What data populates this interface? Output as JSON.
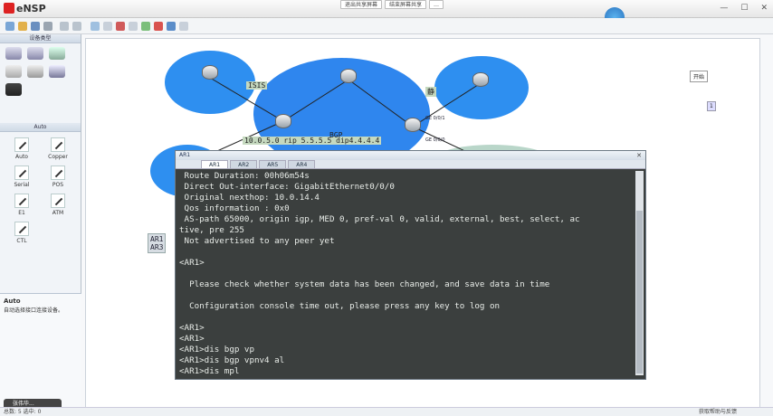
{
  "app": {
    "title": "eNSP"
  },
  "title_menu": [
    "退出共享屏幕",
    "结束屏幕共享",
    "…"
  ],
  "window_controls": [
    "—",
    "☐",
    "✕"
  ],
  "left_panel": {
    "top_header": "设备类型",
    "cable_header": "Auto",
    "cables": [
      {
        "label": "Auto",
        "icon": "auto-cable-icon"
      },
      {
        "label": "Copper",
        "icon": "copper-cable-icon"
      },
      {
        "label": "Serial",
        "icon": "serial-cable-icon"
      },
      {
        "label": "POS",
        "icon": "pos-cable-icon"
      },
      {
        "label": "E1",
        "icon": "e1-cable-icon"
      },
      {
        "label": "ATM",
        "icon": "atm-cable-icon"
      },
      {
        "label": "CTL",
        "icon": "ctl-cable-icon"
      }
    ],
    "desc_title": "Auto",
    "desc_text": "自动选择接口连接设备。",
    "user_pill": "张伟华..."
  },
  "topology": {
    "tags": {
      "isis": "ISIS",
      "jing": "静",
      "rip": "10.0.5.0 rip 5.5.5.5 dip4.4.4.4",
      "bgp": "BGP"
    },
    "labels": {
      "ge1": "GE 0/0/1",
      "ge2": "GE 0/0/0"
    },
    "right_tag": "开始",
    "right_tag2": "1",
    "side_ar": [
      "AR1",
      "AR3"
    ]
  },
  "console": {
    "title": "AR1",
    "tabs": [
      "AR1",
      "AR2",
      "AR5",
      "AR4"
    ],
    "active_tab": 0,
    "lines": [
      " Route Duration: 00h06m54s",
      " Direct Out-interface: GigabitEthernet0/0/0",
      " Original nexthop: 10.0.14.4",
      " Qos information : 0x0",
      " AS-path 65000, origin igp, MED 0, pref-val 0, valid, external, best, select, ac",
      "tive, pre 255",
      " Not advertised to any peer yet",
      "",
      "<AR1>",
      "",
      "  Please check whether system data has been changed, and save data in time",
      "",
      "  Configuration console time out, please press any key to log on",
      "",
      "<AR1>",
      "<AR1>",
      "<AR1>dis bgp vp",
      "<AR1>dis bgp vpnv4 al",
      "<AR1>dis mpl"
    ]
  },
  "status": {
    "left": "总数: 5 选中: 0",
    "right": "获取帮助与反馈"
  }
}
